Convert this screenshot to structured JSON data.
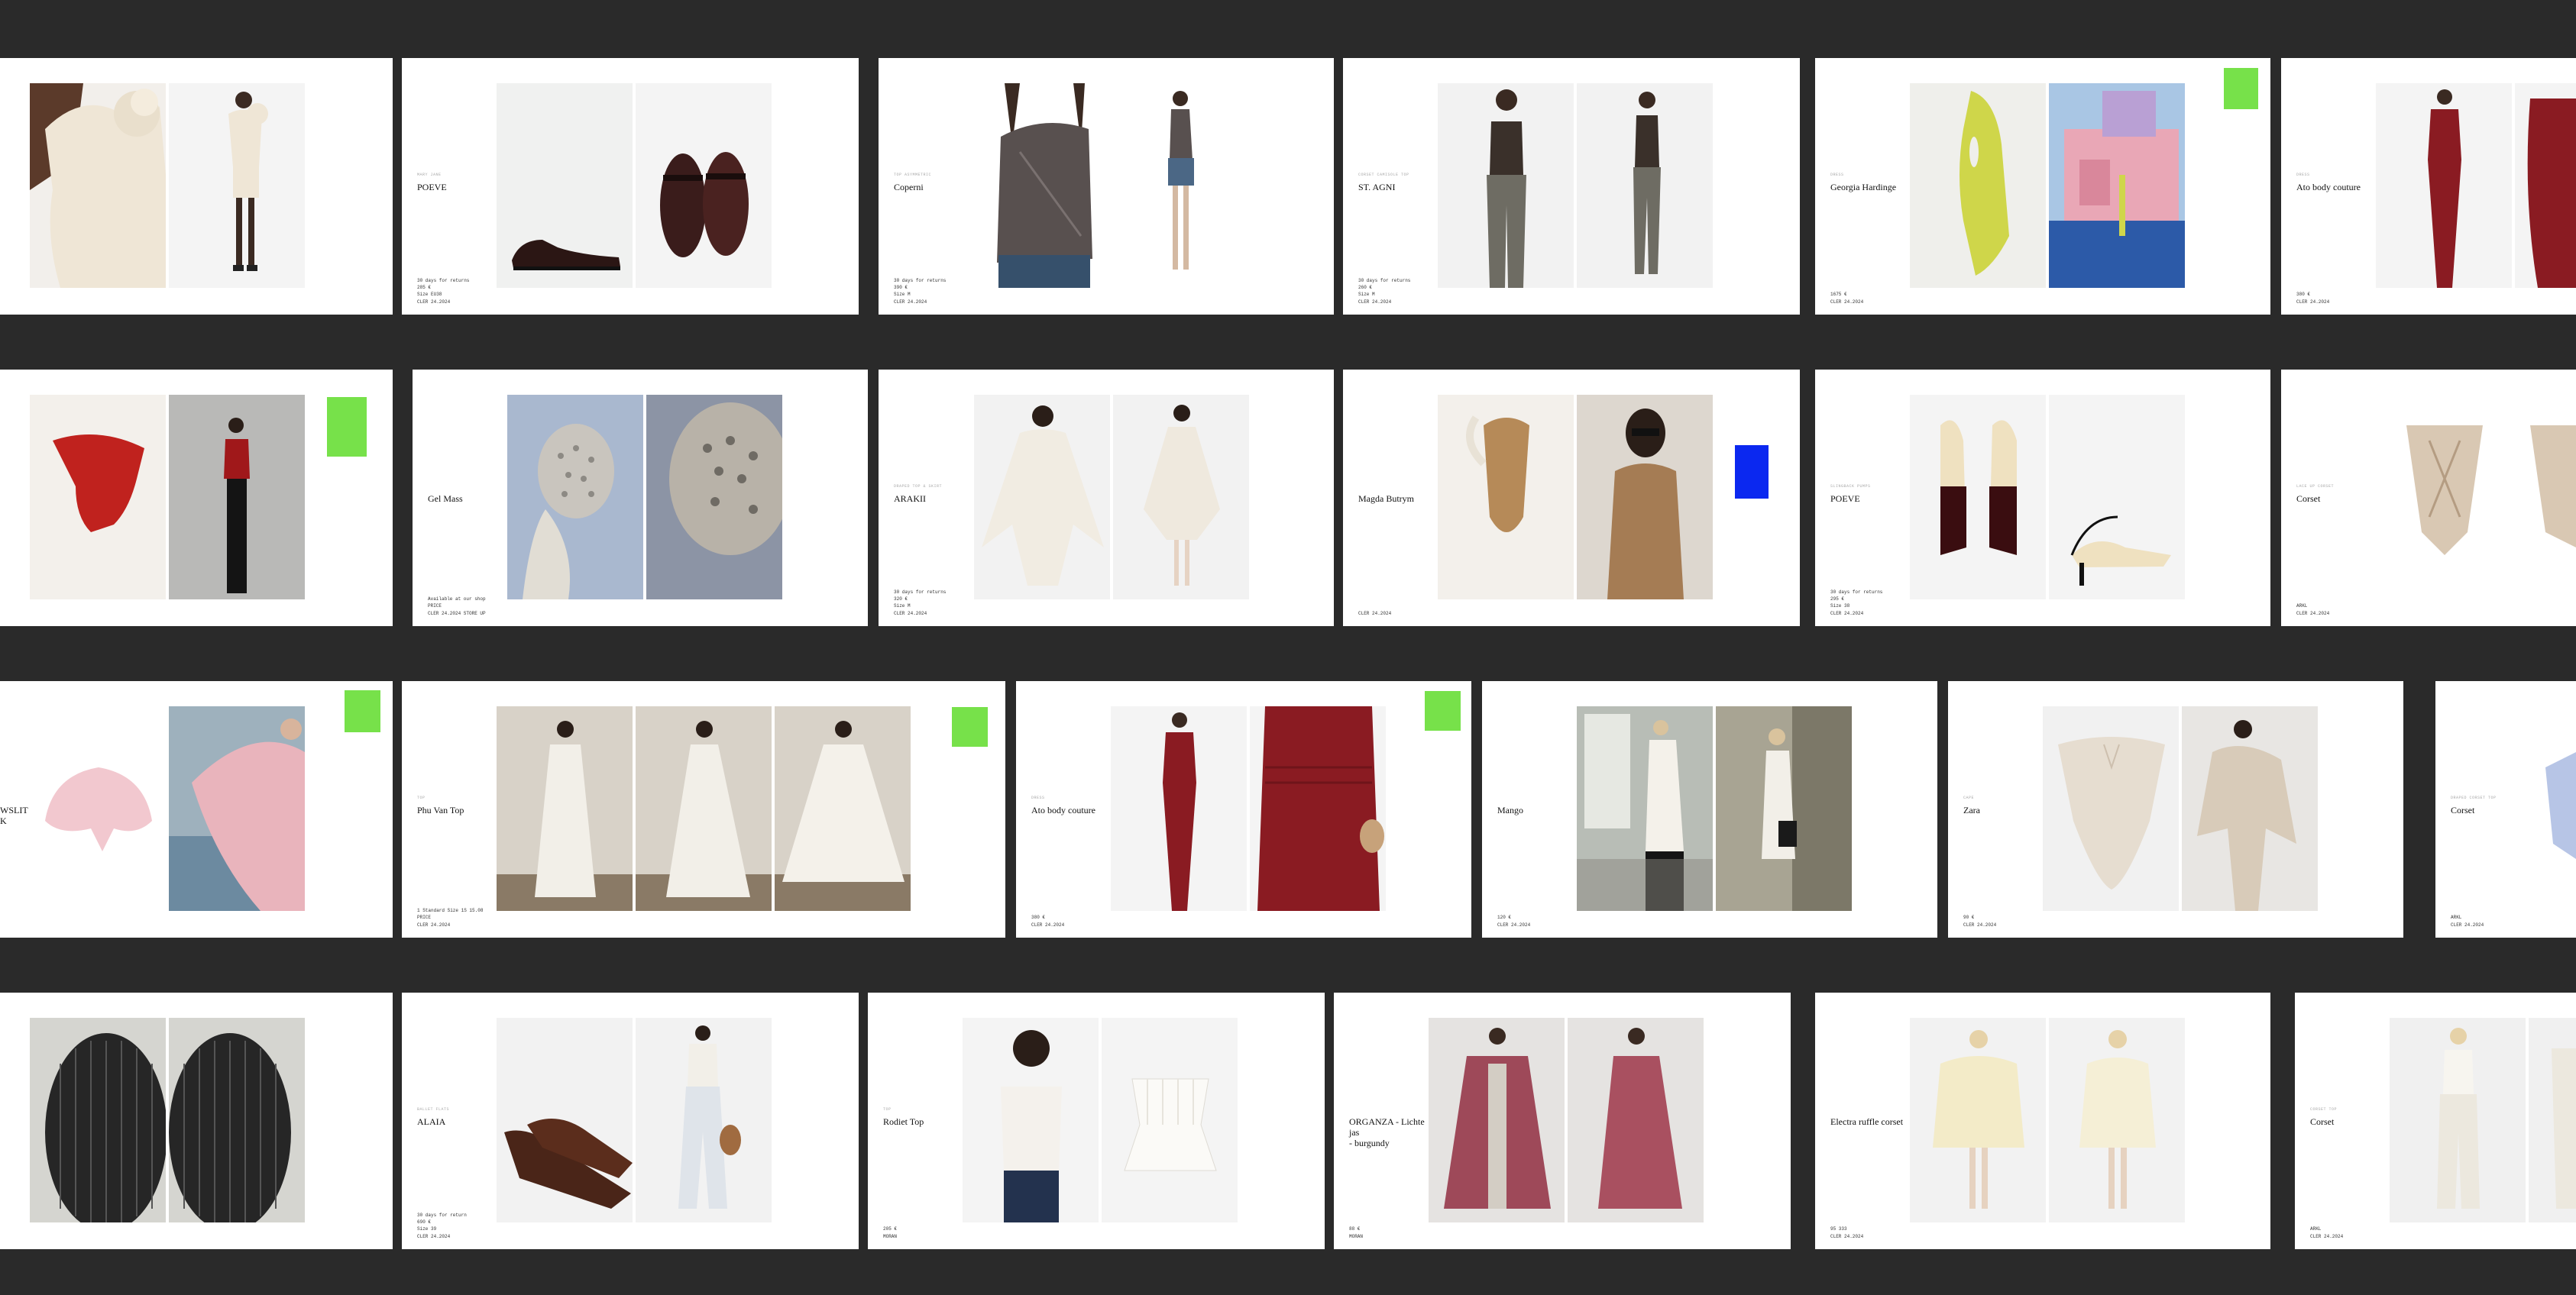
{
  "colors": {
    "background": "#2a2a2a",
    "card": "#ffffff",
    "accent_green": "#77e14a",
    "accent_blue": "#0b28f0"
  },
  "rows": [
    [
      {
        "brand": "",
        "tagline": "",
        "meta": "",
        "swatch": null,
        "photos": [
          {
            "subject": "ivory-ruffle-top-closeup",
            "bg": "#f2efeb"
          },
          {
            "subject": "ivory-ruffle-top-model",
            "bg": "#f4f4f4"
          }
        ]
      },
      {
        "brand": "POEVE",
        "tagline": "MARY JANE",
        "meta": "30 days for returns\n285 €\nSize EU38\nCLER 24.2024",
        "swatch": null,
        "photos": [
          {
            "subject": "maryjane-shoe-side",
            "bg": "#f0f1f0"
          },
          {
            "subject": "maryjane-shoe-pair",
            "bg": "#f4f4f4"
          }
        ]
      },
      {
        "brand": "Coperni",
        "tagline": "TOP ASYMMETRIC",
        "meta": "30 days for returns\n390 €\nSize M\nCLER 24.2024",
        "swatch": null,
        "photos": [
          {
            "subject": "draped-top-closeup",
            "bg": "#ffffff"
          },
          {
            "subject": "draped-top-model",
            "bg": "#ffffff"
          }
        ]
      },
      {
        "brand": "ST. AGNI",
        "tagline": "CORSET CAMISOLE TOP",
        "meta": "30 days for returns\n260 €\nSize M\nCLER 24.2024",
        "swatch": null,
        "photos": [
          {
            "subject": "camisole-grey-pants-front",
            "bg": "#f2f2f2"
          },
          {
            "subject": "camisole-grey-pants-side",
            "bg": "#f2f2f2"
          }
        ]
      },
      {
        "brand": "Georgia Hardinge",
        "tagline": "DRESS",
        "meta": "1675 €\nCLER 24.2024",
        "swatch": "accent_green",
        "photos": [
          {
            "subject": "lime-dress-flat",
            "bg": "#efefeb"
          },
          {
            "subject": "pink-building-pool",
            "bg": "#e9b7c3"
          }
        ]
      },
      {
        "brand": "Ato body couture",
        "tagline": "DRESS",
        "meta": "380 €\nCLER 24.2024",
        "swatch": null,
        "photos": [
          {
            "subject": "red-gown-model",
            "bg": "#f4f4f4"
          },
          {
            "subject": "red-gown-crop",
            "bg": "#f4f4f4"
          }
        ]
      }
    ],
    [
      {
        "brand": "",
        "tagline": "",
        "meta": "",
        "swatch": "accent_green",
        "photos": [
          {
            "subject": "red-sculpted-top-flat",
            "bg": "#f3f0eb"
          },
          {
            "subject": "red-top-black-pants-model",
            "bg": "#b9b9b7"
          }
        ]
      },
      {
        "brand": "Gel Mass",
        "tagline": "",
        "meta": "Available at our shop\nPRICE\nCLER 24.2024  STORE UP",
        "swatch": null,
        "photos": [
          {
            "subject": "mesh-mask-blue",
            "bg": "#a9b8cf"
          },
          {
            "subject": "mesh-mask-closeup",
            "bg": "#8c94a5"
          }
        ]
      },
      {
        "brand": "ARAKII",
        "tagline": "DRAPED TOP & SKIRT",
        "meta": "30 days for returns\n320 €\nSize M\nCLER 24.2024",
        "swatch": null,
        "photos": [
          {
            "subject": "ivory-cape-model-a",
            "bg": "#f2f2f2"
          },
          {
            "subject": "ivory-cape-model-b",
            "bg": "#f2f2f2"
          }
        ]
      },
      {
        "brand": "Magda Butrym",
        "tagline": "",
        "meta": "CLER 24.2024",
        "swatch": "accent_blue",
        "photos": [
          {
            "subject": "tan-bodysuit-flat",
            "bg": "#f3f0eb"
          },
          {
            "subject": "tan-bodysuit-model",
            "bg": "#c9b39a"
          }
        ]
      },
      {
        "brand": "POEVE",
        "tagline": "SLINGBACK PUMPS",
        "meta": "30 days for returns\n295 €\nSize 38\nCLER 24.2024",
        "swatch": null,
        "photos": [
          {
            "subject": "slingback-pair",
            "bg": "#f4f4f4"
          },
          {
            "subject": "slingback-side",
            "bg": "#f4f4f4"
          }
        ]
      },
      {
        "brand": "Corset",
        "tagline": "LACE UP CORSET",
        "meta": "ARKL\nCLER 24.2024",
        "swatch": null,
        "photos": [
          {
            "subject": "beige-corset-a",
            "bg": "#ffffff"
          },
          {
            "subject": "beige-corset-b",
            "bg": "#ffffff"
          }
        ]
      }
    ],
    [
      {
        "brand": "WSLIT\nK",
        "tagline": "",
        "meta": "",
        "swatch": "accent_green",
        "photos": [
          {
            "subject": "pink-pleat-fan-flat",
            "bg": "#ffffff"
          },
          {
            "subject": "pink-pleat-model-sea",
            "bg": "#9eb1bd"
          }
        ]
      },
      {
        "brand": "Phu Van Top",
        "tagline": "TOP",
        "meta": "1 Standard Size  1S  15.08\nPRICE\nCLER 24.2024",
        "swatch": "accent_green",
        "photos": [
          {
            "subject": "white-pleat-top-a",
            "bg": "#d8d2c8"
          },
          {
            "subject": "white-pleat-top-b",
            "bg": "#d8d2c8"
          },
          {
            "subject": "white-pleat-top-c",
            "bg": "#d8d2c8"
          }
        ]
      },
      {
        "brand": "Ato body couture",
        "tagline": "DRESS",
        "meta": "380 €\nCLER 24.2024",
        "swatch": "accent_green",
        "photos": [
          {
            "subject": "red-gown-model-2",
            "bg": "#f4f4f4"
          },
          {
            "subject": "red-skirt-bag-crop",
            "bg": "#f4f4f4"
          }
        ]
      },
      {
        "brand": "Mango",
        "tagline": "",
        "meta": "120 €\nCLER 24.2024",
        "swatch": null,
        "photos": [
          {
            "subject": "white-draped-top-window",
            "bg": "#9aa09a"
          },
          {
            "subject": "white-top-outdoor",
            "bg": "#8f8a7c"
          }
        ]
      },
      {
        "brand": "Zara",
        "tagline": "CAPE",
        "meta": "90 €\nCLER 24.2024",
        "swatch": null,
        "photos": [
          {
            "subject": "beige-cape-flat",
            "bg": "#f1f1f1"
          },
          {
            "subject": "beige-cape-model",
            "bg": "#e8e6e3"
          }
        ]
      },
      {
        "brand": "Corset",
        "tagline": "DRAPED CORSET TOP",
        "meta": "ARKL\nCLER 24.2024",
        "swatch": null,
        "photos": [
          {
            "subject": "blue-corset",
            "bg": "#ffffff"
          }
        ]
      }
    ],
    [
      {
        "brand": "",
        "tagline": "",
        "meta": "",
        "swatch": null,
        "photos": [
          {
            "subject": "woven-mask-back-a",
            "bg": "#3b3b3b"
          },
          {
            "subject": "woven-mask-back-b",
            "bg": "#444444"
          }
        ]
      },
      {
        "brand": "ALAIA",
        "tagline": "BALLET FLATS",
        "meta": "30 days for return\n690 €\nSize 39\nCLER 24.2024",
        "swatch": null,
        "photos": [
          {
            "subject": "brown-ballet-flats",
            "bg": "#f2f2f2"
          },
          {
            "subject": "white-jeans-model",
            "bg": "#f2f2f2"
          }
        ]
      },
      {
        "brand": "Rodiet Top",
        "tagline": "TOP",
        "meta": "205 €\nMORAN",
        "swatch": null,
        "photos": [
          {
            "subject": "white-bustier-model",
            "bg": "#f4f4f4"
          },
          {
            "subject": "white-bustier-flat",
            "bg": "#f4f4f4"
          }
        ]
      },
      {
        "brand": "ORGANZA - Lichte jas\n- burgundy",
        "tagline": "",
        "meta": "88 €\nMORAN",
        "swatch": null,
        "photos": [
          {
            "subject": "burgundy-organza-front",
            "bg": "#e5e3e1"
          },
          {
            "subject": "burgundy-organza-side",
            "bg": "#e5e3e1"
          }
        ]
      },
      {
        "brand": "Electra ruffle corset",
        "tagline": "",
        "meta": "95 333\nCLER 24.2024",
        "swatch": null,
        "photos": [
          {
            "subject": "yellow-ruffle-corset-a",
            "bg": "#f2f2f2"
          },
          {
            "subject": "yellow-ruffle-corset-b",
            "bg": "#f2f2f2"
          }
        ]
      },
      {
        "brand": "Corset",
        "tagline": "CORSET TOP",
        "meta": "ARKL\nCLER 24.2024",
        "swatch": null,
        "photos": [
          {
            "subject": "white-corset-pants-a",
            "bg": "#f0f0f0"
          },
          {
            "subject": "white-corset-pants-b",
            "bg": "#f0f0f0"
          }
        ]
      }
    ]
  ]
}
